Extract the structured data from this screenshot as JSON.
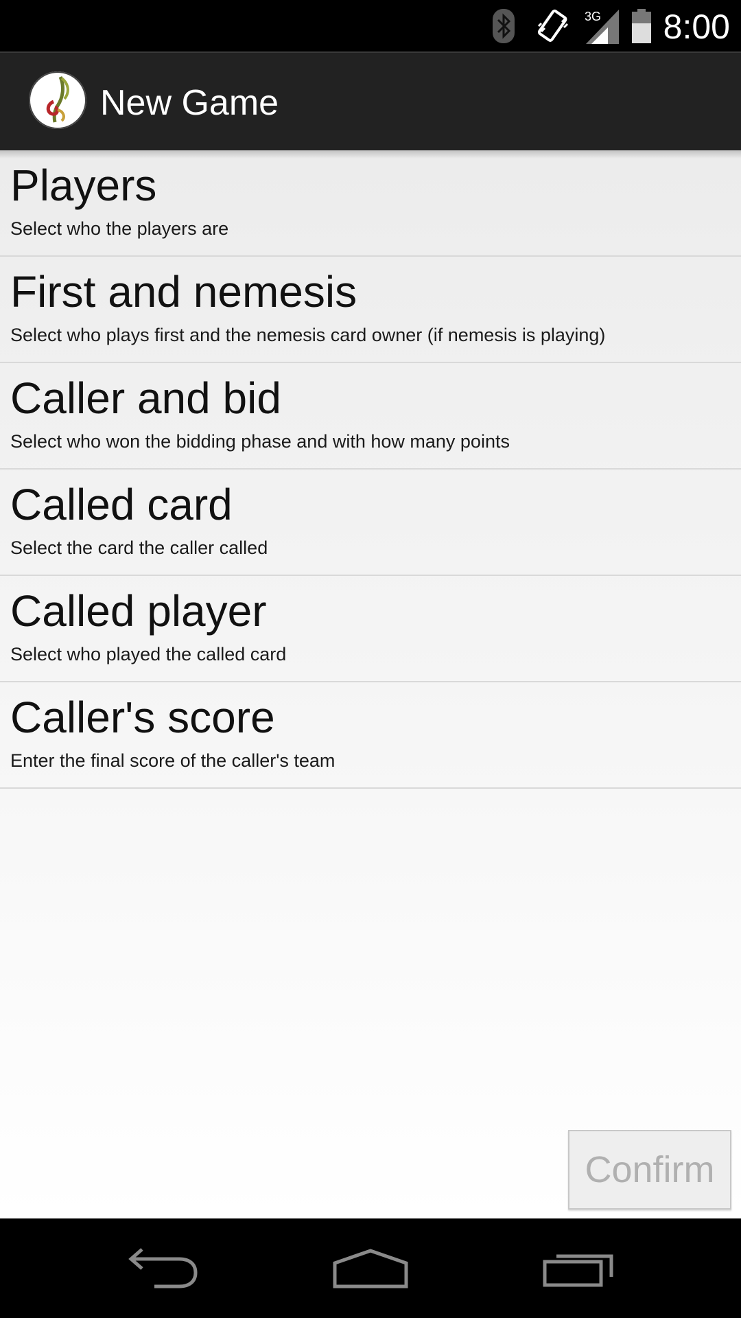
{
  "status_bar": {
    "time": "8:00",
    "icons": [
      "bluetooth-icon",
      "vibrate-icon",
      "signal-3g-icon",
      "battery-icon"
    ],
    "network_label": "3G"
  },
  "action_bar": {
    "title": "New Game",
    "app_icon": "app-logo-icon"
  },
  "list": {
    "items": [
      {
        "title": "Players",
        "subtitle": "Select who the players are"
      },
      {
        "title": "First and nemesis",
        "subtitle": "Select who plays first and the nemesis card owner (if nemesis is playing)"
      },
      {
        "title": "Caller and bid",
        "subtitle": "Select who won the bidding phase and with how many points"
      },
      {
        "title": "Called card",
        "subtitle": "Select the card the caller called"
      },
      {
        "title": "Called player",
        "subtitle": "Select who played the called card"
      },
      {
        "title": "Caller's score",
        "subtitle": "Enter the final score of the caller's team"
      }
    ]
  },
  "confirm": {
    "label": "Confirm",
    "enabled": false
  },
  "nav_bar": {
    "icons": [
      "back-icon",
      "home-icon",
      "recent-apps-icon"
    ]
  },
  "colors": {
    "status_bg": "#000000",
    "action_bar_bg": "#222222",
    "text_primary": "#111111",
    "disabled_text": "#b0b0b0"
  }
}
